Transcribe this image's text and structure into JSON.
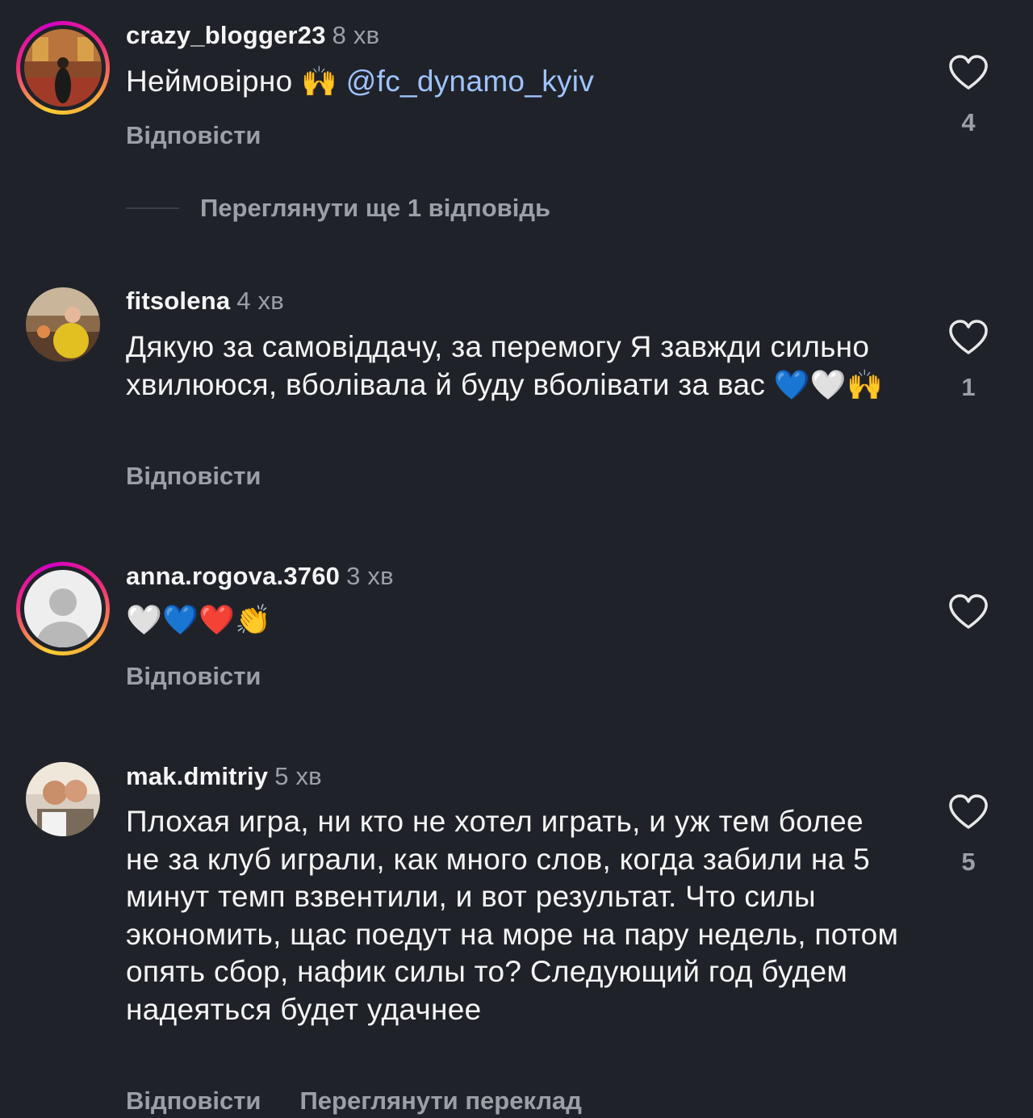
{
  "colors": {
    "background": "#1f2329",
    "text": "#f5f5f5",
    "secondary": "#9aa0a6",
    "mention": "#9fc3ff"
  },
  "comments": [
    {
      "username": "crazy_blogger23",
      "time": "8 хв",
      "text": "Неймовірно",
      "emoji": "🙌",
      "mention": "@fc_dynamo_kyiv",
      "reply": "Відповісти",
      "likes": "4",
      "view_replies": "Переглянути ще 1 відповідь",
      "has_story": true
    },
    {
      "username": "fitsolena",
      "time": "4 хв",
      "text": "Дякую за самовіддачу, за перемогу Я завжди сильно хвилююся, вболівала й буду вболівати за вас",
      "emoji": "💙🤍🙌",
      "reply": "Відповісти",
      "likes": "1",
      "has_story": false
    },
    {
      "username": "anna.rogova.3760",
      "time": "3 хв",
      "emoji": "🤍💙❤️👏",
      "reply": "Відповісти",
      "likes": "",
      "has_story": true
    },
    {
      "username": "mak.dmitriy",
      "time": "5 хв",
      "text": "Плохая игра, ни кто не хотел играть, и уж тем более не за клуб играли, как много слов, когда забили на 5 минут темп взвентили, и вот результат. Что силы экономить, щас поедут на море на пару недель, потом опять сбор, нафик силы то? Следующий год будем надеяться будет удачнее",
      "reply": "Відповісти",
      "translate": "Переглянути переклад",
      "likes": "5",
      "has_story": false
    }
  ],
  "icons": {
    "like": "heart-outline-icon",
    "default_avatar": "person-placeholder-icon"
  }
}
